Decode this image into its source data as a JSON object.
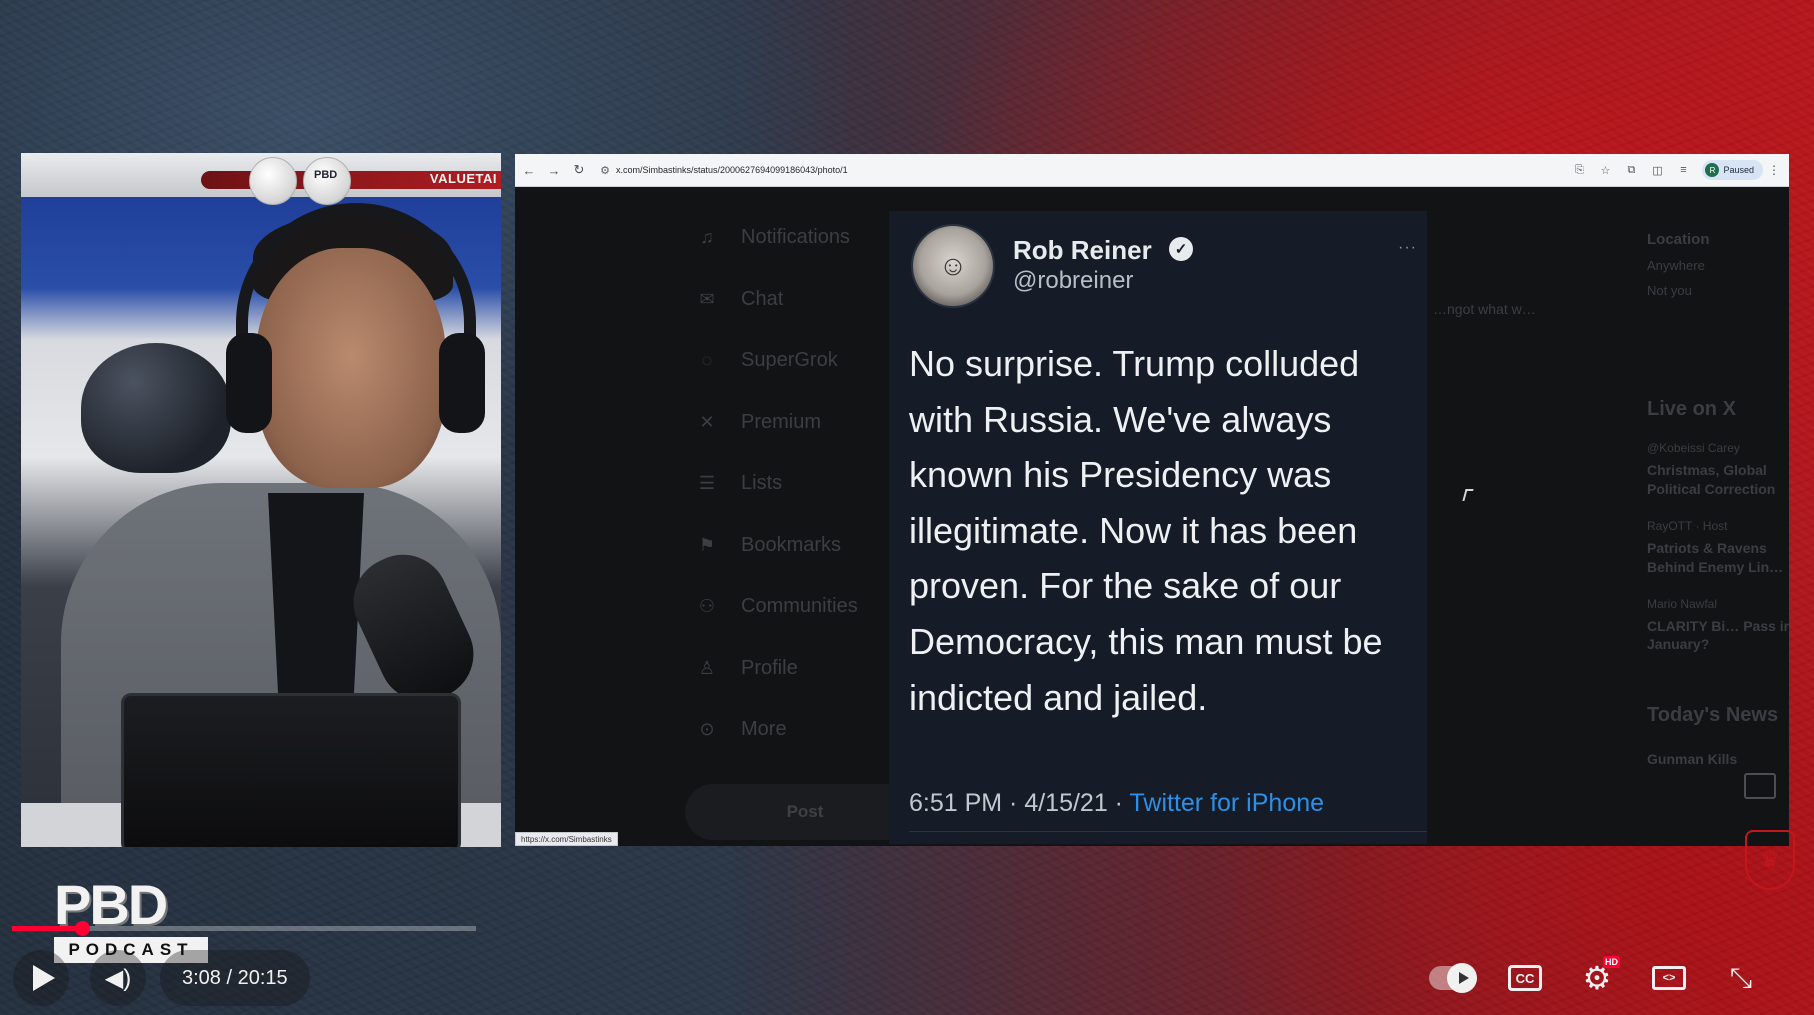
{
  "browser": {
    "url": "x.com/Simbastinks/status/2000627694099186043/photo/1",
    "profile_initial": "R",
    "profile_status": "Paused",
    "status_link": "https://x.com/Simbastinks"
  },
  "host_panel": {
    "shelf_text": "VALUETAI",
    "ball_label": "PBD"
  },
  "x_nav": {
    "items": [
      {
        "label": "Notifications",
        "icon": "bell-icon"
      },
      {
        "label": "Chat",
        "icon": "mail-icon"
      },
      {
        "label": "SuperGrok",
        "icon": "grok-icon"
      },
      {
        "label": "Premium",
        "icon": "x-logo-icon"
      },
      {
        "label": "Lists",
        "icon": "list-icon"
      },
      {
        "label": "Bookmarks",
        "icon": "bookmark-icon"
      },
      {
        "label": "Communities",
        "icon": "people-icon"
      },
      {
        "label": "Profile",
        "icon": "person-icon"
      },
      {
        "label": "More",
        "icon": "more-icon"
      }
    ],
    "post_label": "Post"
  },
  "x_middle": {
    "snippet": "…ngot what w…"
  },
  "x_right": {
    "location_label": "Location",
    "location_value": "Anywhere",
    "not_you": "Not you",
    "live_heading": "Live on X",
    "trends": [
      {
        "meta": "@Kobeissi Carey",
        "title": "Christmas, Global Political Correction"
      },
      {
        "meta": "RayOTT · Host",
        "title": "Patriots & Ravens Behind Enemy Lin…"
      },
      {
        "meta": "Mario Nawfal",
        "title": "CLARITY Bi… Pass in January?"
      }
    ],
    "news_heading": "Today's News",
    "news_item": "Gunman Kills"
  },
  "tweet": {
    "name": "Rob Reiner",
    "handle": "@robreiner",
    "text": "No surprise. Trump colluded with Russia. We've always known his Presidency was illegitimate. Now it has been proven. For the sake of our Democracy, this man must be indicted and jailed.",
    "time": "6:51 PM · 4/15/21 · ",
    "via": "Twitter for iPhone",
    "more": "···"
  },
  "logo": {
    "main": "PBD",
    "sub": "PODCAST"
  },
  "player": {
    "time": "3:08 / 20:15",
    "progress": 0.15,
    "hd_badge": "HD",
    "cc_label": "CC",
    "accent": "#ff0033"
  }
}
